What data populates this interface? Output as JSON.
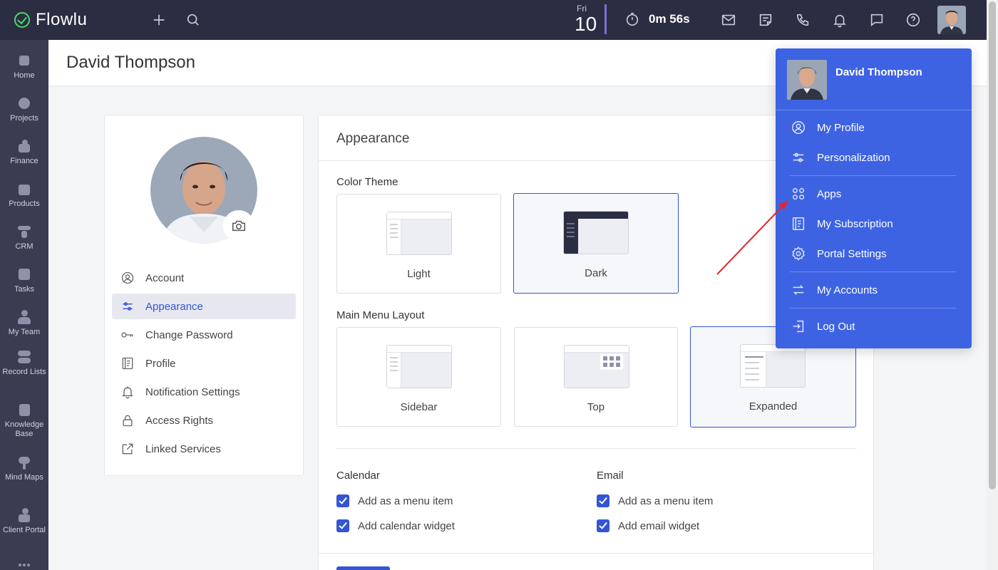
{
  "topbar": {
    "app_name": "Flowlu",
    "date_dow": "Fri",
    "date_num": "10",
    "timer": "0m 56s",
    "icons": [
      "plus-icon",
      "search-icon",
      "timer-icon",
      "mail-icon",
      "notes-icon",
      "phone-icon",
      "bell-icon",
      "chat-icon",
      "help-icon"
    ]
  },
  "leftnav": {
    "items": [
      {
        "label": "Home"
      },
      {
        "label": "Projects"
      },
      {
        "label": "Finance"
      },
      {
        "label": "Products"
      },
      {
        "label": "CRM"
      },
      {
        "label": "Tasks"
      },
      {
        "label": "My Team"
      },
      {
        "label": "Record Lists"
      },
      {
        "label": "Knowledge Base"
      },
      {
        "label": "Mind Maps"
      },
      {
        "label": "Client Portal"
      }
    ]
  },
  "page": {
    "title": "David Thompson"
  },
  "profile_menu": {
    "items": [
      {
        "label": "Account",
        "icon": "user-circle-icon"
      },
      {
        "label": "Appearance",
        "icon": "sliders-icon",
        "active": true
      },
      {
        "label": "Change Password",
        "icon": "key-icon"
      },
      {
        "label": "Profile",
        "icon": "profile-card-icon"
      },
      {
        "label": "Notification Settings",
        "icon": "bell-icon"
      },
      {
        "label": "Access Rights",
        "icon": "lock-icon"
      },
      {
        "label": "Linked Services",
        "icon": "external-link-icon"
      }
    ]
  },
  "appearance": {
    "title": "Appearance",
    "color_theme_label": "Color Theme",
    "themes": [
      {
        "label": "Light",
        "selected": false
      },
      {
        "label": "Dark",
        "selected": true
      }
    ],
    "menu_layout_label": "Main Menu Layout",
    "layouts": [
      {
        "label": "Sidebar",
        "selected": false
      },
      {
        "label": "Top",
        "selected": false
      },
      {
        "label": "Expanded",
        "selected": true
      }
    ],
    "calendar": {
      "label": "Calendar",
      "opt1": "Add as a menu item",
      "opt2": "Add calendar widget"
    },
    "email": {
      "label": "Email",
      "opt1": "Add as a menu item",
      "opt2": "Add email widget"
    }
  },
  "dropdown": {
    "name": "David Thompson",
    "items": [
      {
        "label": "My Profile",
        "icon": "user-circle-icon"
      },
      {
        "label": "Personalization",
        "icon": "sliders-icon"
      },
      {
        "label": "Apps",
        "icon": "apps-grid-icon"
      },
      {
        "label": "My Subscription",
        "icon": "subscription-icon"
      },
      {
        "label": "Portal Settings",
        "icon": "gear-icon"
      },
      {
        "label": "My Accounts",
        "icon": "switch-accounts-icon"
      },
      {
        "label": "Log Out",
        "icon": "logout-icon"
      }
    ]
  },
  "colors": {
    "topbar": "#2b2d42",
    "leftnav": "#3a3c52",
    "accent": "#3355d6",
    "dropdown": "#3d63e3",
    "annotation_arrow": "#e8242b"
  }
}
